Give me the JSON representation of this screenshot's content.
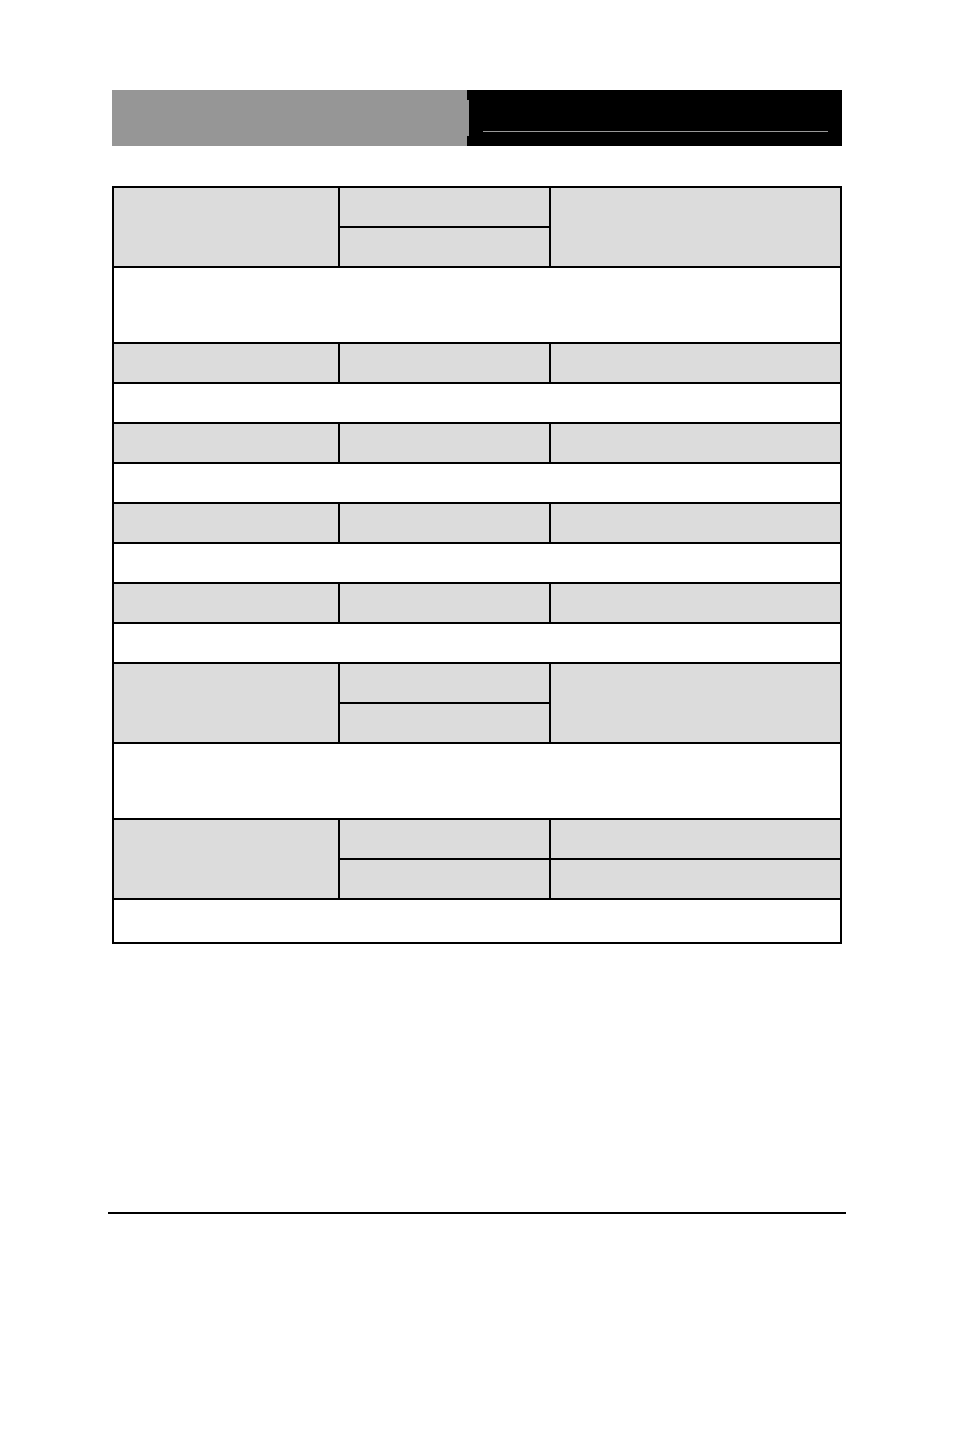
{
  "banner": {
    "left_text": "",
    "right_text": ""
  },
  "table": {
    "rows": [
      {
        "type": "three-col-split",
        "left": "",
        "mid_top": "",
        "mid_bottom": "",
        "right": ""
      },
      {
        "type": "full-white-tall",
        "content": ""
      },
      {
        "type": "three-col-short",
        "left": "",
        "mid": "",
        "right": ""
      },
      {
        "type": "full-white-short",
        "content": ""
      },
      {
        "type": "three-col-short",
        "left": "",
        "mid": "",
        "right": ""
      },
      {
        "type": "full-white-short",
        "content": ""
      },
      {
        "type": "three-col-short",
        "left": "",
        "mid": "",
        "right": ""
      },
      {
        "type": "full-white-short",
        "content": ""
      },
      {
        "type": "three-col-short",
        "left": "",
        "mid": "",
        "right": ""
      },
      {
        "type": "full-white-short",
        "content": ""
      },
      {
        "type": "three-col-split",
        "left": "",
        "mid_top": "",
        "mid_bottom": "",
        "right": ""
      },
      {
        "type": "full-white-tall",
        "content": ""
      },
      {
        "type": "three-col-split-b",
        "left": "",
        "mid_top": "",
        "mid_bottom": "",
        "right_top": "",
        "right_bottom": ""
      },
      {
        "type": "full-white-short",
        "content": ""
      }
    ]
  },
  "footer": {
    "text": ""
  }
}
